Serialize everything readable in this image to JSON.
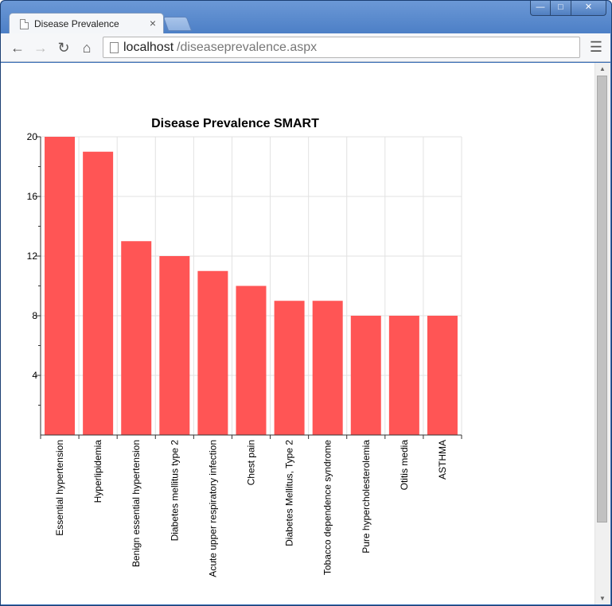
{
  "browser": {
    "tab_title": "Disease Prevalence",
    "tab_close": "×",
    "url_host": "localhost",
    "url_path": "/diseaseprevalence.aspx",
    "window_controls": {
      "minimize": "—",
      "maximize": "□",
      "close": "✕"
    }
  },
  "icons": {
    "back": "back-arrow-icon",
    "forward": "forward-arrow-icon",
    "reload": "reload-icon",
    "home": "home-icon",
    "menu": "hamburger-menu-icon"
  },
  "colors": {
    "bar": "#ff5555",
    "grid": "#e2e2e2",
    "axis": "#333333",
    "accent_frame": "#3b6fb6"
  },
  "chart_data": {
    "type": "bar",
    "title": "Disease Prevalence SMART",
    "xlabel": "",
    "ylabel": "",
    "ylim": [
      0,
      20
    ],
    "yticks": [
      4,
      8,
      12,
      16,
      20
    ],
    "grid": true,
    "categories": [
      "Essential hypertension",
      "Hyperlipidemia",
      "Benign essential hypertension",
      "Diabetes mellitus type 2",
      "Acute upper respiratory infection",
      "Chest pain",
      "Diabetes Mellitus, Type 2",
      "Tobacco dependence syndrome",
      "Pure hypercholesterolemia",
      "Otitis media",
      "ASTHMA"
    ],
    "values": [
      20,
      19,
      13,
      12,
      11,
      10,
      9,
      9,
      8,
      8,
      8
    ]
  }
}
